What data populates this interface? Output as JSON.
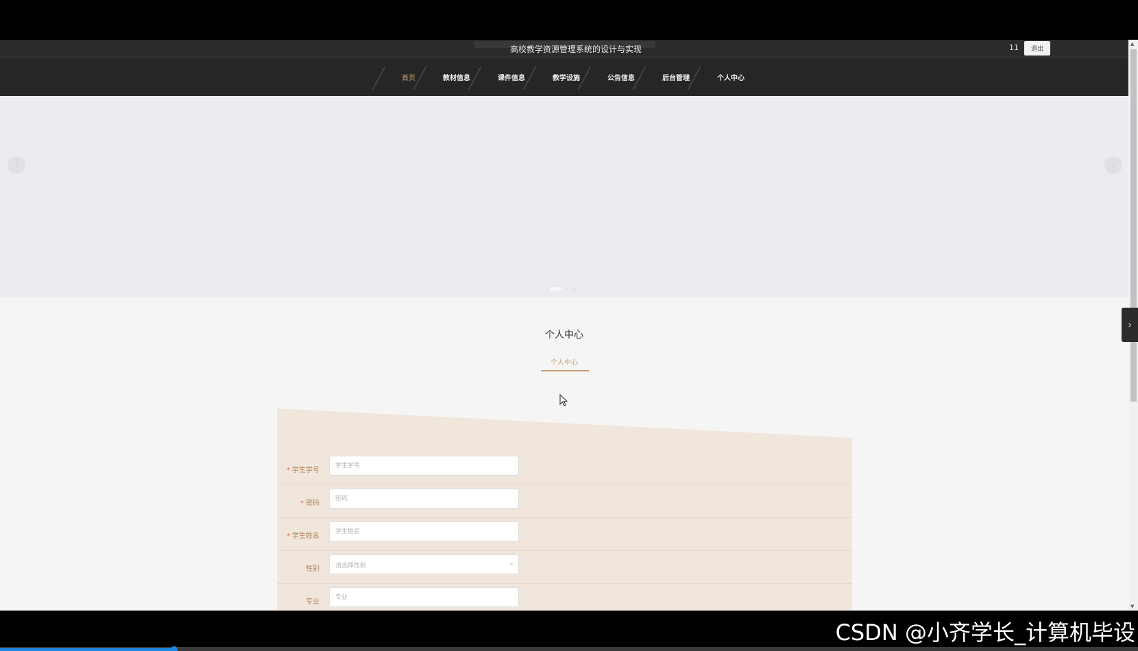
{
  "topbar": {
    "site_title": "高校教学资源管理系统的设计与实现",
    "user_name": "11",
    "logout_label": "退出"
  },
  "nav": {
    "items": [
      {
        "label": "首页",
        "active": true
      },
      {
        "label": "教材信息"
      },
      {
        "label": "课件信息"
      },
      {
        "label": "教学设施"
      },
      {
        "label": "公告信息"
      },
      {
        "label": "后台管理"
      },
      {
        "label": "个人中心"
      }
    ]
  },
  "banner": {
    "prev_icon": "‹",
    "next_icon": "›",
    "slide_count": 3,
    "active_slide": 1
  },
  "section": {
    "title": "个人中心",
    "subtitle": "个人中心"
  },
  "form": {
    "fields": [
      {
        "label": "学生学号",
        "required": true,
        "placeholder": "学生学号"
      },
      {
        "label": "密码",
        "required": true,
        "placeholder": "密码"
      },
      {
        "label": "学生姓名",
        "required": true,
        "placeholder": "学生姓名"
      },
      {
        "label": "性别",
        "required": false,
        "placeholder": "请选择性别"
      },
      {
        "label": "专业",
        "required": false,
        "placeholder": "专业"
      }
    ],
    "required_mark": "*"
  },
  "side_tab_icon": "›",
  "watermark": "CSDN @小齐学长_计算机毕设",
  "video_progress": 0.153,
  "colors": {
    "accent": "#c99d69",
    "nav_bg": "#262626",
    "card_bg": "#f1e6dc"
  }
}
